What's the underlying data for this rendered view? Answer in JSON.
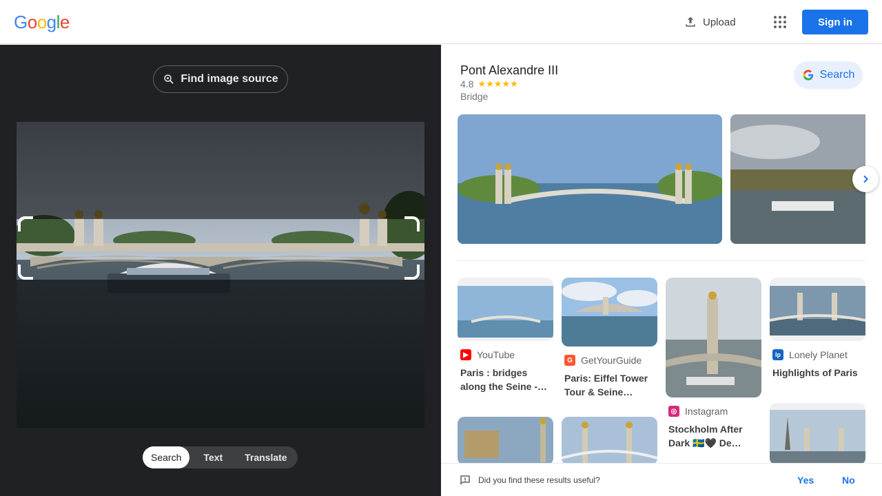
{
  "header": {
    "logo_letters": [
      {
        "ch": "G",
        "color": "#4285f4"
      },
      {
        "ch": "o",
        "color": "#ea4335"
      },
      {
        "ch": "o",
        "color": "#fbbc05"
      },
      {
        "ch": "g",
        "color": "#4285f4"
      },
      {
        "ch": "l",
        "color": "#34a853"
      },
      {
        "ch": "e",
        "color": "#ea4335"
      }
    ],
    "upload_label": "Upload",
    "upload_icon": "upload-icon",
    "apps_icon": "apps-grid-icon",
    "signin_label": "Sign in"
  },
  "left": {
    "find_source_label": "Find image source",
    "modes": [
      {
        "label": "Search",
        "active": true
      },
      {
        "label": "Text",
        "active": false
      },
      {
        "label": "Translate",
        "active": false
      }
    ]
  },
  "knowledge_panel": {
    "title": "Pont Alexandre III",
    "rating": "4.8",
    "stars": "★★★★★",
    "type": "Bridge",
    "search_label": "Search"
  },
  "results": [
    {
      "source": "YouTube",
      "title": "Paris : bridges along the Seine -…",
      "favicon_color": "#ff0000",
      "favicon_glyph": "▶"
    },
    {
      "source": "GetYourGuide",
      "title": "Paris: Eiffel Tower Tour & Seine…",
      "favicon_color": "#ff5533",
      "favicon_glyph": "G"
    },
    {
      "source": "Instagram",
      "title": "Stockholm After Dark 🇸🇪🖤 De…",
      "favicon_color": "#d62976",
      "favicon_glyph": "◎"
    },
    {
      "source": "Lonely Planet",
      "title": "Highlights of Paris",
      "favicon_color": "#1565c0",
      "favicon_glyph": "lp"
    }
  ],
  "feedback": {
    "question": "Did you find these results useful?",
    "yes": "Yes",
    "no": "No"
  },
  "colors": {
    "accent": "#1a73e8",
    "dark_pane": "#202124",
    "star": "#fbbc04"
  }
}
